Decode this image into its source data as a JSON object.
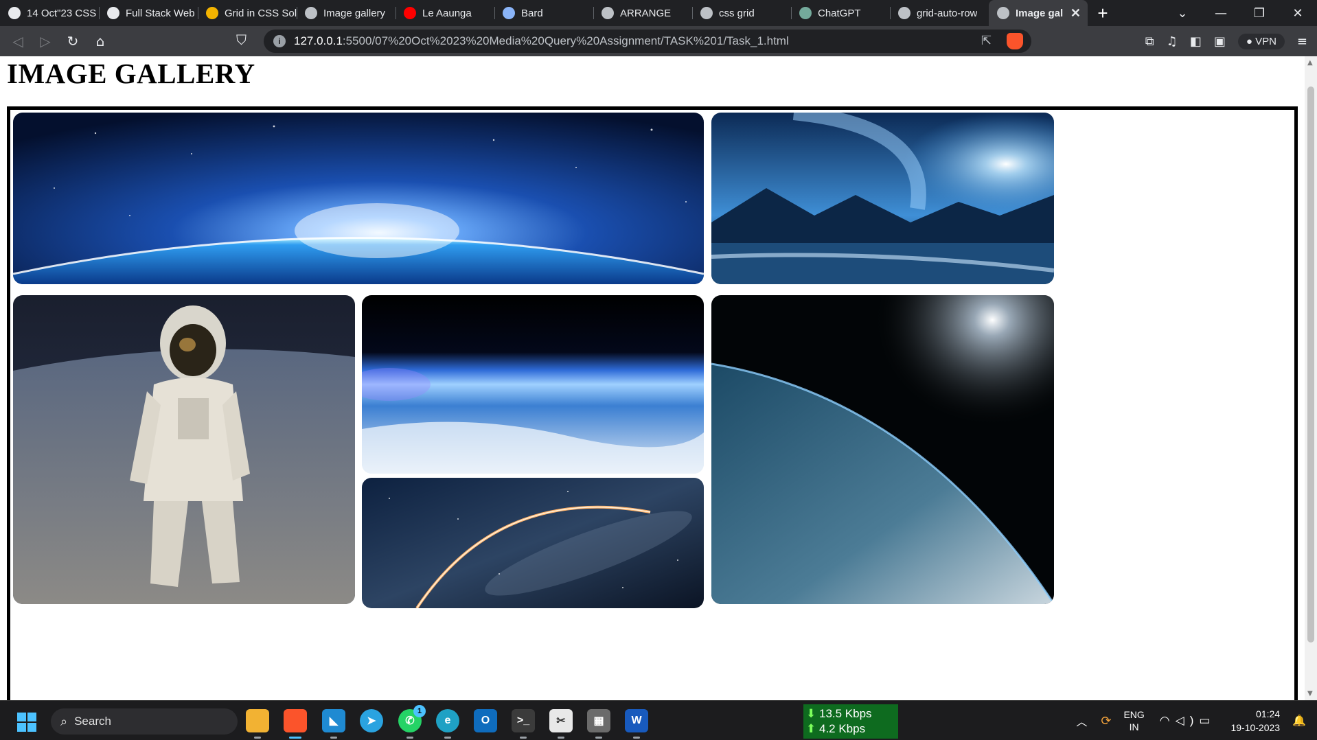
{
  "browser": {
    "tabs": [
      {
        "label": "14 Oct\"23 CSS",
        "icon": "webflow-icon",
        "fav_color": "#e8eaed"
      },
      {
        "label": "Full Stack Web",
        "icon": "webflow-icon",
        "fav_color": "#e8eaed"
      },
      {
        "label": "Grid in CSS Sol",
        "icon": "google-drive-icon",
        "fav_color": "#f4b400"
      },
      {
        "label": "Image gallery",
        "icon": "globe-icon",
        "fav_color": "#bdc1c6"
      },
      {
        "label": "Le Aaunga",
        "icon": "youtube-icon",
        "fav_color": "#ff0000"
      },
      {
        "label": "Bard",
        "icon": "bard-icon",
        "fav_color": "#8ab4f8"
      },
      {
        "label": "ARRANGE",
        "icon": "globe-icon",
        "fav_color": "#bdc1c6"
      },
      {
        "label": "css grid",
        "icon": "globe-icon",
        "fav_color": "#bdc1c6"
      },
      {
        "label": "ChatGPT",
        "icon": "chatgpt-icon",
        "fav_color": "#74aa9c"
      },
      {
        "label": "grid-auto-row",
        "icon": "globe-icon",
        "fav_color": "#bdc1c6"
      },
      {
        "label": "Image gal",
        "icon": "globe-icon",
        "fav_color": "#bdc1c6",
        "active": true
      }
    ],
    "url_host": "127.0.0.1",
    "url_path": ":5500/07%20Oct%2023%20Media%20Query%20Assignment/TASK%201/Task_1.html",
    "vpn_label": "VPN"
  },
  "page": {
    "title": "IMAGE GALLERY",
    "images": [
      {
        "name": "earth-horizon-sunrise"
      },
      {
        "name": "fantasy-planet-landscape"
      },
      {
        "name": "astronaut-on-moon"
      },
      {
        "name": "earth-atmosphere-orbit"
      },
      {
        "name": "rocket-trail-milky-way"
      },
      {
        "name": "earth-from-space-sunlight"
      }
    ]
  },
  "taskbar": {
    "search_label": "Search",
    "net_down": "13.5 Kbps",
    "net_up": "4.2 Kbps",
    "whatsapp_badge": "1",
    "lang_top": "ENG",
    "lang_bottom": "IN",
    "time": "01:24",
    "date": "19-10-2023"
  },
  "colors": {
    "chrome_dark": "#202124",
    "chrome_mid": "#3c3d41",
    "taskbar": "#1c1c1e",
    "net_widget": "#0e6b1f",
    "accent": "#4cc2ff"
  }
}
